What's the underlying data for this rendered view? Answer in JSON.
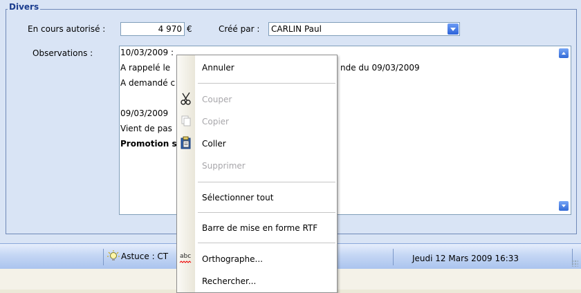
{
  "section": {
    "legend": "Divers",
    "encours_label": "En cours autorisé :",
    "encours_value": "4 970",
    "currency": "€",
    "cree_par_label": "Créé par :",
    "cree_par_value": "CARLIN Paul",
    "observations_label": "Observations :"
  },
  "observations_lines": [
    "10/03/2009 :",
    "A rappelé le",
    "nde du 09/03/2009",
    "A demandé c",
    "09/03/2009",
    "Vient de pas",
    "Promotion s"
  ],
  "context_menu": {
    "items": [
      {
        "label": "Annuler",
        "enabled": true
      },
      {
        "label": "Couper",
        "enabled": false,
        "icon": "scissors-icon"
      },
      {
        "label": "Copier",
        "enabled": false,
        "icon": "copy-icon"
      },
      {
        "label": "Coller",
        "enabled": true,
        "icon": "paste-icon"
      },
      {
        "label": "Supprimer",
        "enabled": false
      },
      {
        "label": "Sélectionner tout",
        "enabled": true
      },
      {
        "label": "Barre de mise en forme RTF",
        "enabled": true
      },
      {
        "label": "Orthographe...",
        "enabled": true,
        "icon": "spellcheck-icon",
        "icon_text": "abc"
      },
      {
        "label": "Rechercher...",
        "enabled": true
      }
    ]
  },
  "statusbar": {
    "tip_text": "Astuce : CT",
    "datetime": "Jeudi 12 Mars 2009 16:33"
  },
  "colors": {
    "panel_bg": "#d9e4f5",
    "legend": "#1b3d8f",
    "accent_blue": "#316ac5"
  }
}
